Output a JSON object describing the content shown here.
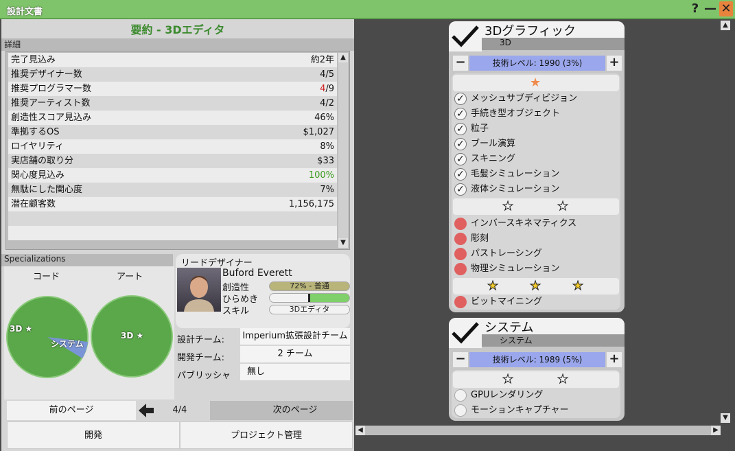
{
  "window": {
    "title": "設計文書",
    "help_label": "?",
    "minimize_label": "—",
    "close_label": "✕"
  },
  "summary": {
    "title": "要約 - 3Dエディタ"
  },
  "details": {
    "label": "詳細",
    "rows": [
      {
        "label": "完了見込み",
        "value": "約2年"
      },
      {
        "label": "推奨デザイナー数",
        "value": "4/5"
      },
      {
        "label": "推奨プログラマー数",
        "value_highlight": "4",
        "value_rest": "/9"
      },
      {
        "label": "推奨アーティスト数",
        "value": "4/2"
      },
      {
        "label": "創造性スコア見込み",
        "value": "46%"
      },
      {
        "label": "準拠するOS",
        "value": "$1,027"
      },
      {
        "label": "ロイヤリティ",
        "value": "8%"
      },
      {
        "label": "実店舗の取り分",
        "value": "$33"
      },
      {
        "label": "関心度見込み",
        "value": "100%"
      },
      {
        "label": "無駄にした関心度",
        "value": "7%"
      },
      {
        "label": "潜在顧客数",
        "value": "1,156,175"
      }
    ]
  },
  "specializations": {
    "label": "Specializations",
    "code_label": "コード",
    "art_label": "アート",
    "code_pie_labels": {
      "a": "3D ★",
      "b": "システム"
    },
    "art_pie_label": "3D ★",
    "code_share": {
      "3D": 0.9,
      "システム": 0.1
    }
  },
  "lead_designer": {
    "label": "リードデザイナー",
    "name": "Buford Everett",
    "creativity_label": "創造性",
    "creativity_value": "72% - 普通",
    "inspiration_label": "ひらめき",
    "inspiration_level": 0.45,
    "skill_label": "スキル",
    "skill_value": "3Dエディタ"
  },
  "teams": {
    "design_label": "設計チーム:",
    "design_value": "Imperium拡張設計チーム",
    "dev_label": "開発チーム:",
    "dev_value": "2 チーム",
    "publisher_label": "パブリッシャ",
    "publisher_value": "無し"
  },
  "pager": {
    "prev_label": "前のページ",
    "page": "4/4",
    "next_label": "次のページ"
  },
  "buttons": {
    "develop": "開発",
    "project": "プロジェクト管理"
  },
  "cards": {
    "graphics": {
      "title": "3Dグラフィック",
      "subtitle": "3D",
      "tech_level": "技術レベル: 1990 (3%)",
      "tier1": [
        "メッシュサブディビジョン",
        "手続き型オブジェクト",
        "粒子",
        "ブール演算",
        "スキニング",
        "毛髪シミュレーション",
        "液体シミュレーション"
      ],
      "tier2": [
        "インバースキネマティクス",
        "彫刻",
        "パストレーシング",
        "物理シミュレーション"
      ],
      "tier3": [
        "ビットマイニング"
      ]
    },
    "system": {
      "title": "システム",
      "subtitle": "システム",
      "tech_level": "技術レベル: 1989 (5%)",
      "tier2": [
        "GPUレンダリング",
        "モーションキャプチャー"
      ]
    }
  },
  "colors": {
    "title_bar": "#7fc46a",
    "accent_green": "#3c8a2e",
    "tech_bar": "#9aa7ec",
    "unavailable": "#e06060",
    "star_orange": "#f08a4b",
    "star_yellow": "#f4cc2a"
  }
}
